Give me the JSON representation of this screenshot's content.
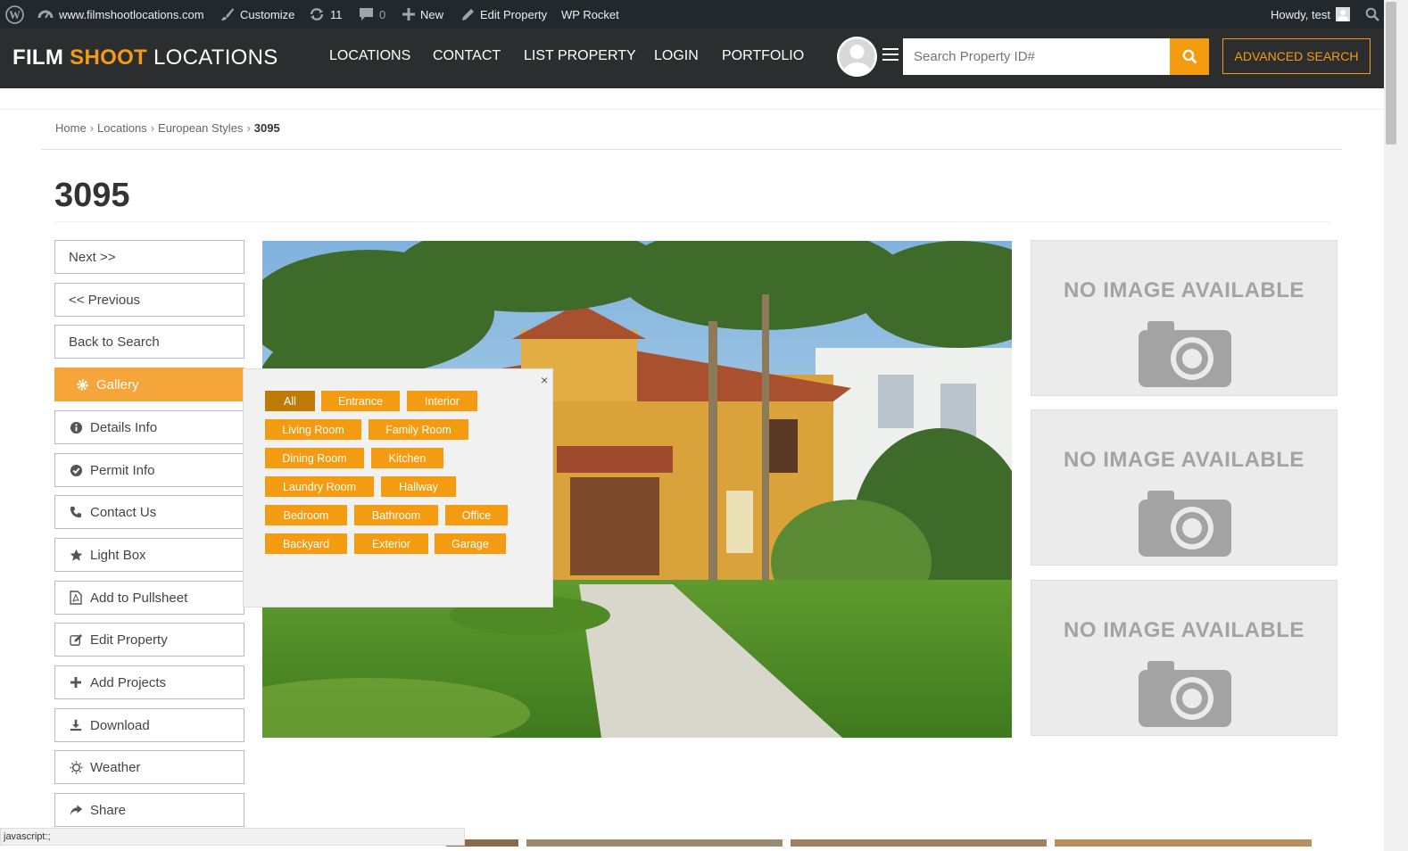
{
  "admin_bar": {
    "site_url": "www.filmshootlocations.com",
    "customize": "Customize",
    "updates_count": "11",
    "comments_count": "0",
    "new_label": "New",
    "edit_property": "Edit Property",
    "wp_rocket": "WP Rocket",
    "greeting": "Howdy, test"
  },
  "header": {
    "logo_part1": "FILM",
    "logo_part2": "SHOOT",
    "logo_part3": "LOCATIONS",
    "nav": [
      "LOCATIONS",
      "CONTACT",
      "LIST PROPERTY",
      "LOGIN",
      "PORTFOLIO"
    ],
    "search_placeholder": "Search Property ID#",
    "advanced_search": "ADVANCED SEARCH",
    "accent_color": "#f39c12"
  },
  "breadcrumb": {
    "items": [
      "Home",
      "Locations",
      "European Styles"
    ],
    "current": "3095"
  },
  "page_title": "3095",
  "sidebar": {
    "buttons": [
      {
        "label": "Next >>",
        "icon": ""
      },
      {
        "label": "<< Previous",
        "icon": ""
      },
      {
        "label": "Back to Search",
        "icon": ""
      },
      {
        "label": "Gallery",
        "icon": "gear-icon",
        "active": true
      },
      {
        "label": "Details Info",
        "icon": "info-icon"
      },
      {
        "label": "Permit Info",
        "icon": "check-circle-icon"
      },
      {
        "label": "Contact Us",
        "icon": "phone-icon"
      },
      {
        "label": "Light Box",
        "icon": "star-icon"
      },
      {
        "label": "Add to Pullsheet",
        "icon": "pdf-file-icon"
      },
      {
        "label": "Edit Property",
        "icon": "edit-icon"
      },
      {
        "label": "Add Projects",
        "icon": "plus-icon"
      },
      {
        "label": "Download",
        "icon": "download-icon"
      },
      {
        "label": "Weather",
        "icon": "sun-icon"
      },
      {
        "label": "Share",
        "icon": "share-icon"
      }
    ]
  },
  "gallery_popup": {
    "close": "×",
    "tags": [
      "All",
      "Entrance",
      "Interior",
      "Living Room",
      "Family Room",
      "Dining Room",
      "Kitchen",
      "Laundry Room",
      "Hallway",
      "Bedroom",
      "Bathroom",
      "Office",
      "Backyard",
      "Exterior",
      "Garage"
    ],
    "selected": "All"
  },
  "placeholders": {
    "text": "NO IMAGE AVAILABLE"
  },
  "status_bar": "javascript:;"
}
